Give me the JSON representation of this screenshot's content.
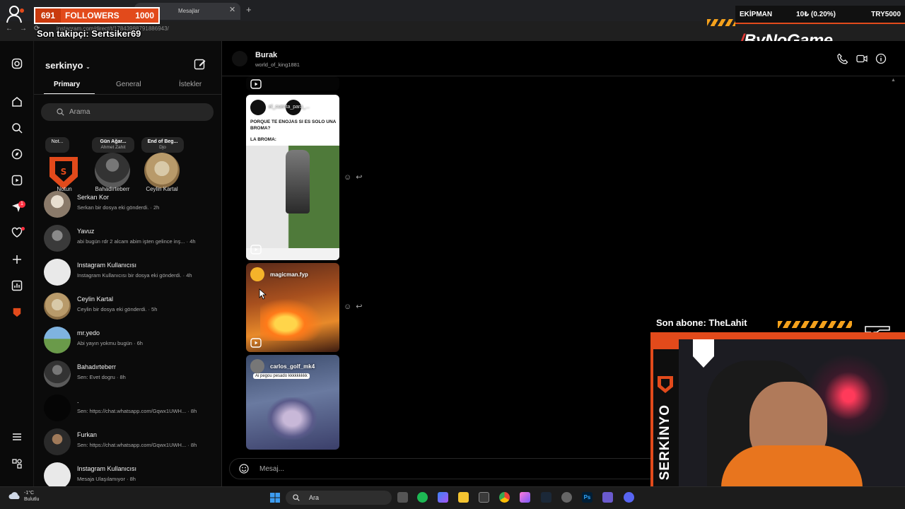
{
  "overlay": {
    "followers_count": "691",
    "followers_label": "FOLLOWERS",
    "followers_goal": "1000",
    "last_follower": "Son takipçi: Sertsiker69",
    "equipment_label": "EKİPMAN",
    "stat": "10₺ (0.20%)",
    "donation": "TRY5000",
    "brand_a": "ByNo",
    "brand_b": "Game",
    "last_sub": "Son abone: TheLahit",
    "streamer": "SERKİNYO"
  },
  "browser": {
    "tab_title": "Mesajlar",
    "url": "instagram.com/direct/t/17843988791886943/"
  },
  "inbox": {
    "username": "serkinyo",
    "tabs": [
      "Primary",
      "General",
      "İstekler"
    ],
    "search_placeholder": "Arama",
    "notes": [
      {
        "bubble": "Not...",
        "bubble_sub": "",
        "name": "Notun"
      },
      {
        "bubble": "Gün Ağar...",
        "bubble_sub": "Ahmet Zahit",
        "name": "Bahadırteberr"
      },
      {
        "bubble": "End of Beg...",
        "bubble_sub": "Djo",
        "name": "Ceylin Kartal"
      }
    ],
    "conversations": [
      {
        "name": "Serkan Kor",
        "preview": "Serkan bir dosya eki gönderdi. · 2h"
      },
      {
        "name": "Yavuz",
        "preview": "abi bugün rdr 2 alcam abim işten gelince inş... · 4h"
      },
      {
        "name": "Instagram Kullanıcısı",
        "preview": "Instagram Kullanıcısı bir dosya eki gönderdi. · 4h"
      },
      {
        "name": "Ceylin Kartal",
        "preview": "Ceylin bir dosya eki gönderdi. · 5h"
      },
      {
        "name": "mr.yedo",
        "preview": "Abi yayın yokmu bugün · 6h"
      },
      {
        "name": "Bahadırteberr",
        "preview": "Sen: Evet dogru · 8h"
      },
      {
        "name": ".",
        "preview": "Sen: https://chat.whatsapp.com/Gqwx1UWH... · 8h"
      },
      {
        "name": "Furkan",
        "preview": "Sen: https://chat.whatsapp.com/Gqwx1UWH... · 8h"
      },
      {
        "name": "Instagram Kullanıcısı",
        "preview": "Mesaja Ulaşılamıyor · 8h"
      }
    ]
  },
  "chat": {
    "name": "Burak",
    "username": "world_of_king1881",
    "reel1_author": "el_cuenta_para_...",
    "reel1_caption": "PORQUE TE ENOJAS SI ES SOLO UNA BROMA?",
    "reel1_sub": "LA BROMA:",
    "reel2_author": "magicman.fyp",
    "reel3_author": "carlos_golf_mk4",
    "reel3_caption": "Ai pegou pesado kkkkkkkkk",
    "message_placeholder": "Mesaj..."
  },
  "taskbar": {
    "temp": "-1°C",
    "weather": "Bulutlu",
    "search": "Ara"
  },
  "rail_badge": "1",
  "colors": {
    "accent": "#e24a1b",
    "ig_red": "#ff3040",
    "stripes": "#f4a11c"
  }
}
